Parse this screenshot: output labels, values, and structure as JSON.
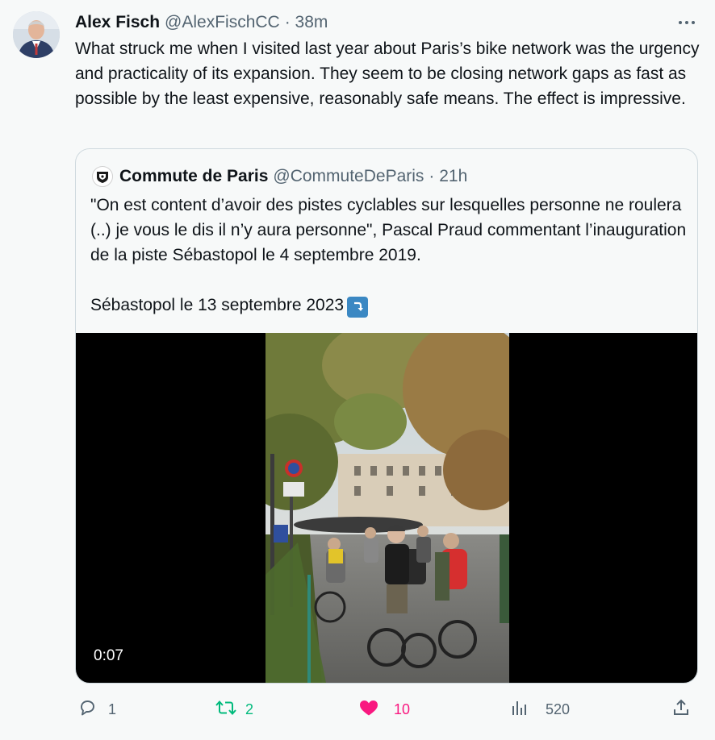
{
  "tweet": {
    "author_name": "Alex Fisch",
    "author_handle": "@AlexFischCC",
    "time": "· 38m",
    "text": "What struck me when I visited last year about Paris’s bike network was the urgency and practicality of its expansion. They seem to be closing network gaps as fast as possible by the least expensive, reasonably safe means. The effect is impressive."
  },
  "quoted": {
    "author_name": "Commute de Paris",
    "author_handle": "@CommuteDeParis",
    "time": "· 21h",
    "text_1": "\"On est content d’avoir des pistes cyclables sur lesquelles personne ne roulera (..) je vous le dis il n’y aura personne\", Pascal Praud commentant l’inauguration de la piste Sébastopol le 4 septembre 2019.",
    "text_2": "Sébastopol le 13 septembre 2023",
    "video_duration": "0:07"
  },
  "actions": {
    "reply_count": "1",
    "retweet_count": "2",
    "like_count": "10",
    "views_count": "520"
  },
  "icons": [
    "more-icon",
    "reply-icon",
    "retweet-icon",
    "like-icon",
    "views-icon",
    "share-icon",
    "return-arrow-emoji"
  ],
  "colors": {
    "retweet": "#00ba7c",
    "like": "#f91880",
    "muted": "#536471",
    "emoji_blue": "#3b88c3"
  }
}
